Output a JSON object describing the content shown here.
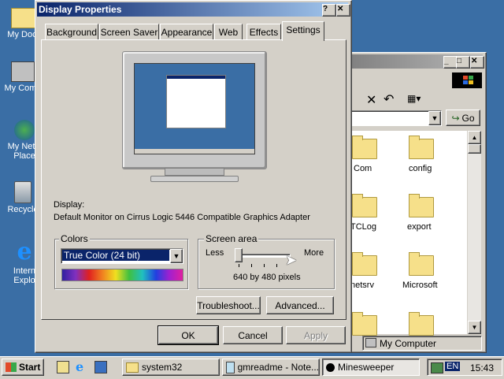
{
  "desktop": {
    "icons": [
      {
        "label": "My Docu"
      },
      {
        "label": "My Comp"
      },
      {
        "label": "My Netw"
      },
      {
        "label": "Place"
      },
      {
        "label": "Recycle"
      },
      {
        "label": "Intern"
      },
      {
        "label": "Explo"
      }
    ]
  },
  "explorer": {
    "go_label": "Go",
    "folders": [
      {
        "label": "Com"
      },
      {
        "label": "config"
      },
      {
        "label": "TCLog"
      },
      {
        "label": "export"
      },
      {
        "label": "netsrv"
      },
      {
        "label": "Microsoft"
      }
    ],
    "status_label": "My Computer"
  },
  "dialog": {
    "title": "Display Properties",
    "help_label": "?",
    "close_label": "✕",
    "tabs": [
      {
        "label": "Background"
      },
      {
        "label": "Screen Saver"
      },
      {
        "label": "Appearance"
      },
      {
        "label": "Web"
      },
      {
        "label": "Effects"
      },
      {
        "label": "Settings"
      }
    ],
    "active_tab": "Settings",
    "display_caption": "Display:",
    "display_value": "Default Monitor on Cirrus Logic 5446 Compatible Graphics Adapter",
    "colors": {
      "label": "Colors",
      "selected": "True Color (24 bit)"
    },
    "screen_area": {
      "label": "Screen area",
      "less": "Less",
      "more": "More",
      "value_text": "640 by 480 pixels",
      "slider_position": 0
    },
    "buttons": {
      "troubleshoot": "Troubleshoot...",
      "advanced": "Advanced...",
      "ok": "OK",
      "cancel": "Cancel",
      "apply": "Apply"
    }
  },
  "taskbar": {
    "start_label": "Start",
    "tasks": [
      {
        "label": "system32"
      },
      {
        "label": "gmreadme - Note..."
      },
      {
        "label": "Minesweeper"
      }
    ],
    "lang": "EN",
    "clock": "15:43"
  }
}
